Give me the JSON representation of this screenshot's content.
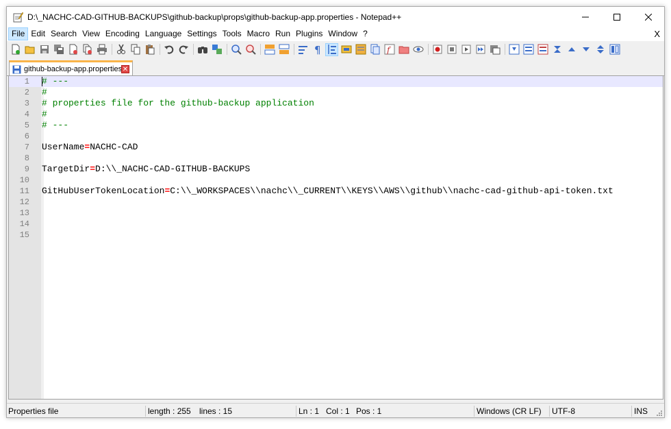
{
  "window": {
    "title": "D:\\_NACHC-CAD-GITHUB-BACKUPS\\github-backup\\props\\github-backup-app.properties - Notepad++",
    "controls": {
      "minimize": "—",
      "maximize": "☐",
      "close": "✕"
    }
  },
  "menu": {
    "items": [
      {
        "label": "File",
        "name": "menu-file"
      },
      {
        "label": "Edit",
        "name": "menu-edit"
      },
      {
        "label": "Search",
        "name": "menu-search"
      },
      {
        "label": "View",
        "name": "menu-view"
      },
      {
        "label": "Encoding",
        "name": "menu-encoding"
      },
      {
        "label": "Language",
        "name": "menu-language"
      },
      {
        "label": "Settings",
        "name": "menu-settings"
      },
      {
        "label": "Tools",
        "name": "menu-tools"
      },
      {
        "label": "Macro",
        "name": "menu-macro"
      },
      {
        "label": "Run",
        "name": "menu-run"
      },
      {
        "label": "Plugins",
        "name": "menu-plugins"
      },
      {
        "label": "Window",
        "name": "menu-window"
      },
      {
        "label": "?",
        "name": "menu-help"
      }
    ],
    "close_doc": "X"
  },
  "tabs": [
    {
      "label": "github-backup-app.properties",
      "active": true
    }
  ],
  "editor": {
    "lines": [
      {
        "n": "1",
        "type": "comment",
        "text": "# ---"
      },
      {
        "n": "2",
        "type": "comment",
        "text": "#"
      },
      {
        "n": "3",
        "type": "comment",
        "text": "# properties file for the github-backup application"
      },
      {
        "n": "4",
        "type": "comment",
        "text": "#"
      },
      {
        "n": "5",
        "type": "comment",
        "text": "# ---"
      },
      {
        "n": "6",
        "type": "empty",
        "text": ""
      },
      {
        "n": "7",
        "type": "kv",
        "key": "UserName",
        "eq": "=",
        "value": "NACHC-CAD"
      },
      {
        "n": "8",
        "type": "empty",
        "text": ""
      },
      {
        "n": "9",
        "type": "kv",
        "key": "TargetDir",
        "eq": "=",
        "value": "D:\\\\_NACHC-CAD-GITHUB-BACKUPS"
      },
      {
        "n": "10",
        "type": "empty",
        "text": ""
      },
      {
        "n": "11",
        "type": "kv",
        "key": "GitHubUserTokenLocation",
        "eq": "=",
        "value": "C:\\\\_WORKSPACES\\\\nachc\\\\_CURRENT\\\\KEYS\\\\AWS\\\\github\\\\nachc-cad-github-api-token.txt"
      },
      {
        "n": "12",
        "type": "empty",
        "text": ""
      },
      {
        "n": "13",
        "type": "empty",
        "text": ""
      },
      {
        "n": "14",
        "type": "empty",
        "text": ""
      },
      {
        "n": "15",
        "type": "empty",
        "text": ""
      }
    ]
  },
  "status": {
    "file_type": "Properties file",
    "length": "length : 255",
    "lines": "lines : 15",
    "ln": "Ln : 1",
    "col": "Col : 1",
    "pos": "Pos : 1",
    "eol": "Windows (CR LF)",
    "encoding": "UTF-8",
    "mode": "INS"
  },
  "colors": {
    "comment": "#008000",
    "operator": "#ff0000",
    "tab_accent": "#fab448",
    "current_line": "#e8e8ff"
  }
}
